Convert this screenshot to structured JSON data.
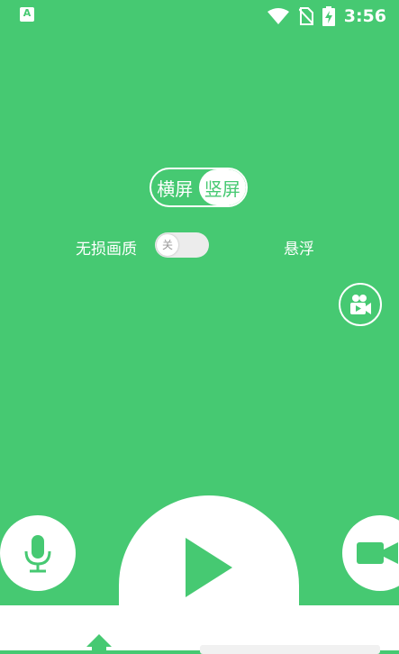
{
  "status_bar": {
    "app_icon_letter": "A",
    "time": "3:56"
  },
  "orientation_toggle": {
    "landscape": "横屏",
    "portrait": "竖屏",
    "selected": "portrait"
  },
  "options": {
    "lossless_label": "无损画质",
    "lossless_switch_text": "关",
    "lossless_switch_on": false,
    "floating_label": "悬浮"
  },
  "colors": {
    "accent_green": "#46C972",
    "white": "#FFFFFF"
  },
  "icons": {
    "record_side": "video-camera-icon",
    "mic": "microphone-icon",
    "play": "play-icon",
    "camera": "video-camera-icon",
    "home": "home-icon"
  }
}
